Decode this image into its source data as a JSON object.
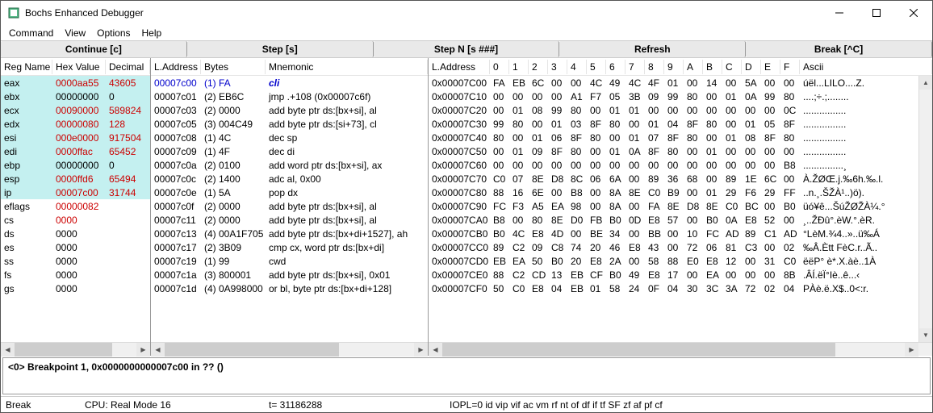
{
  "window": {
    "title": "Bochs Enhanced Debugger"
  },
  "menu": {
    "items": [
      "Command",
      "View",
      "Options",
      "Help"
    ]
  },
  "toolbar": {
    "buttons": [
      "Continue [c]",
      "Step [s]",
      "Step N [s ###]",
      "Refresh",
      "Break [^C]"
    ]
  },
  "registers": {
    "headers": [
      "Reg Name",
      "Hex Value",
      "Decimal"
    ],
    "rows": [
      {
        "name": "eax",
        "hex": "0000aa55",
        "dec": "43605",
        "hl": true,
        "red": true
      },
      {
        "name": "ebx",
        "hex": "00000000",
        "dec": "0",
        "hl": true,
        "red": false
      },
      {
        "name": "ecx",
        "hex": "00090000",
        "dec": "589824",
        "hl": true,
        "red": true
      },
      {
        "name": "edx",
        "hex": "00000080",
        "dec": "128",
        "hl": true,
        "red": true
      },
      {
        "name": "esi",
        "hex": "000e0000",
        "dec": "917504",
        "hl": true,
        "red": true
      },
      {
        "name": "edi",
        "hex": "0000ffac",
        "dec": "65452",
        "hl": true,
        "red": true
      },
      {
        "name": "ebp",
        "hex": "00000000",
        "dec": "0",
        "hl": true,
        "red": false
      },
      {
        "name": "esp",
        "hex": "0000ffd6",
        "dec": "65494",
        "hl": true,
        "red": true
      },
      {
        "name": "ip",
        "hex": "00007c00",
        "dec": "31744",
        "hl": true,
        "red": true
      },
      {
        "name": "eflags",
        "hex": "00000082",
        "dec": "",
        "hl": false,
        "red": true
      },
      {
        "name": "cs",
        "hex": "0000",
        "dec": "",
        "hl": false,
        "red": true
      },
      {
        "name": "ds",
        "hex": "0000",
        "dec": "",
        "hl": false,
        "red": false
      },
      {
        "name": "es",
        "hex": "0000",
        "dec": "",
        "hl": false,
        "red": false
      },
      {
        "name": "ss",
        "hex": "0000",
        "dec": "",
        "hl": false,
        "red": false
      },
      {
        "name": "fs",
        "hex": "0000",
        "dec": "",
        "hl": false,
        "red": false
      },
      {
        "name": "gs",
        "hex": "0000",
        "dec": "",
        "hl": false,
        "red": false
      }
    ]
  },
  "disasm": {
    "headers": [
      "L.Address",
      "Bytes",
      "Mnemonic"
    ],
    "rows": [
      {
        "addr": "00007c00",
        "bytes": "(1) FA",
        "mnem": "cli",
        "hl": true
      },
      {
        "addr": "00007c01",
        "bytes": "(2) EB6C",
        "mnem": "jmp .+108 (0x00007c6f)"
      },
      {
        "addr": "00007c03",
        "bytes": "(2) 0000",
        "mnem": "add byte ptr ds:[bx+si], al"
      },
      {
        "addr": "00007c05",
        "bytes": "(3) 004C49",
        "mnem": "add byte ptr ds:[si+73], cl"
      },
      {
        "addr": "00007c08",
        "bytes": "(1) 4C",
        "mnem": "dec sp"
      },
      {
        "addr": "00007c09",
        "bytes": "(1) 4F",
        "mnem": "dec di"
      },
      {
        "addr": "00007c0a",
        "bytes": "(2) 0100",
        "mnem": "add word ptr ds:[bx+si], ax"
      },
      {
        "addr": "00007c0c",
        "bytes": "(2) 1400",
        "mnem": "adc al, 0x00"
      },
      {
        "addr": "00007c0e",
        "bytes": "(1) 5A",
        "mnem": "pop dx"
      },
      {
        "addr": "00007c0f",
        "bytes": "(2) 0000",
        "mnem": "add byte ptr ds:[bx+si], al"
      },
      {
        "addr": "00007c11",
        "bytes": "(2) 0000",
        "mnem": "add byte ptr ds:[bx+si], al"
      },
      {
        "addr": "00007c13",
        "bytes": "(4) 00A1F705",
        "mnem": "add byte ptr ds:[bx+di+1527], ah"
      },
      {
        "addr": "00007c17",
        "bytes": "(2) 3B09",
        "mnem": "cmp cx, word ptr ds:[bx+di]"
      },
      {
        "addr": "00007c19",
        "bytes": "(1) 99",
        "mnem": "cwd"
      },
      {
        "addr": "00007c1a",
        "bytes": "(3) 800001",
        "mnem": "add byte ptr ds:[bx+si], 0x01"
      },
      {
        "addr": "00007c1d",
        "bytes": "(4) 0A998000",
        "mnem": "or bl, byte ptr ds:[bx+di+128]"
      }
    ]
  },
  "memory": {
    "headers": [
      "L.Address",
      "0",
      "1",
      "2",
      "3",
      "4",
      "5",
      "6",
      "7",
      "8",
      "9",
      "A",
      "B",
      "C",
      "D",
      "E",
      "F",
      "Ascii"
    ],
    "rows": [
      {
        "addr": "0x00007C00",
        "b": [
          "FA",
          "EB",
          "6C",
          "00",
          "00",
          "4C",
          "49",
          "4C",
          "4F",
          "01",
          "00",
          "14",
          "00",
          "5A",
          "00",
          "00"
        ],
        "ascii": "úël...LILO....Z."
      },
      {
        "addr": "0x00007C10",
        "b": [
          "00",
          "00",
          "00",
          "00",
          "A1",
          "F7",
          "05",
          "3B",
          "09",
          "99",
          "80",
          "00",
          "01",
          "0A",
          "99",
          "80"
        ],
        "ascii": "....;÷.;........"
      },
      {
        "addr": "0x00007C20",
        "b": [
          "00",
          "01",
          "08",
          "99",
          "80",
          "00",
          "01",
          "01",
          "00",
          "00",
          "00",
          "00",
          "00",
          "00",
          "00",
          "0C"
        ],
        "ascii": "................"
      },
      {
        "addr": "0x00007C30",
        "b": [
          "99",
          "80",
          "00",
          "01",
          "03",
          "8F",
          "80",
          "00",
          "01",
          "04",
          "8F",
          "80",
          "00",
          "01",
          "05",
          "8F"
        ],
        "ascii": "................"
      },
      {
        "addr": "0x00007C40",
        "b": [
          "80",
          "00",
          "01",
          "06",
          "8F",
          "80",
          "00",
          "01",
          "07",
          "8F",
          "80",
          "00",
          "01",
          "08",
          "8F",
          "80"
        ],
        "ascii": "................"
      },
      {
        "addr": "0x00007C50",
        "b": [
          "00",
          "01",
          "09",
          "8F",
          "80",
          "00",
          "01",
          "0A",
          "8F",
          "80",
          "00",
          "01",
          "00",
          "00",
          "00",
          "00"
        ],
        "ascii": "................"
      },
      {
        "addr": "0x00007C60",
        "b": [
          "00",
          "00",
          "00",
          "00",
          "00",
          "00",
          "00",
          "00",
          "00",
          "00",
          "00",
          "00",
          "00",
          "00",
          "00",
          "B8"
        ],
        "ascii": "...............¸"
      },
      {
        "addr": "0x00007C70",
        "b": [
          "C0",
          "07",
          "8E",
          "D8",
          "8C",
          "06",
          "6A",
          "00",
          "89",
          "36",
          "68",
          "00",
          "89",
          "1E",
          "6C",
          "00"
        ],
        "ascii": "À.ŽØŒ.j.‰6h.‰.l."
      },
      {
        "addr": "0x00007C80",
        "b": [
          "88",
          "16",
          "6E",
          "00",
          "B8",
          "00",
          "8A",
          "8E",
          "C0",
          "B9",
          "00",
          "01",
          "29",
          "F6",
          "29",
          "FF"
        ],
        "ascii": "..n.¸.ŠŽÀ¹..)ö)."
      },
      {
        "addr": "0x00007C90",
        "b": [
          "FC",
          "F3",
          "A5",
          "EA",
          "98",
          "00",
          "8A",
          "00",
          "FA",
          "8E",
          "D8",
          "8E",
          "C0",
          "BC",
          "00",
          "B0"
        ],
        "ascii": "üó¥ê...ŠúŽØŽÀ¼.°"
      },
      {
        "addr": "0x00007CA0",
        "b": [
          "B8",
          "00",
          "80",
          "8E",
          "D0",
          "FB",
          "B0",
          "0D",
          "E8",
          "57",
          "00",
          "B0",
          "0A",
          "E8",
          "52",
          "00"
        ],
        "ascii": "¸..ŽÐû°.èW.°.èR."
      },
      {
        "addr": "0x00007CB0",
        "b": [
          "B0",
          "4C",
          "E8",
          "4D",
          "00",
          "BE",
          "34",
          "00",
          "BB",
          "00",
          "10",
          "FC",
          "AD",
          "89",
          "C1",
          "AD"
        ],
        "ascii": "°LèM.¾4..»..ü­‰Á­"
      },
      {
        "addr": "0x00007CC0",
        "b": [
          "89",
          "C2",
          "09",
          "C8",
          "74",
          "20",
          "46",
          "E8",
          "43",
          "00",
          "72",
          "06",
          "81",
          "C3",
          "00",
          "02"
        ],
        "ascii": "‰Â.Ètt FèC.r..Ã.."
      },
      {
        "addr": "0x00007CD0",
        "b": [
          "EB",
          "EA",
          "50",
          "B0",
          "20",
          "E8",
          "2A",
          "00",
          "58",
          "88",
          "E0",
          "E8",
          "12",
          "00",
          "31",
          "C0"
        ],
        "ascii": "ëëP° è*.X.àè..1À"
      },
      {
        "addr": "0x00007CE0",
        "b": [
          "88",
          "C2",
          "CD",
          "13",
          "EB",
          "CF",
          "B0",
          "49",
          "E8",
          "17",
          "00",
          "EA",
          "00",
          "00",
          "00",
          "8B"
        ],
        "ascii": ".ÂÍ.ëÏ°Iè..ê...‹"
      },
      {
        "addr": "0x00007CF0",
        "b": [
          "50",
          "C0",
          "E8",
          "04",
          "EB",
          "01",
          "58",
          "24",
          "0F",
          "04",
          "30",
          "3C",
          "3A",
          "72",
          "02",
          "04"
        ],
        "ascii": "PÀè.ë.X$..0<:r."
      }
    ]
  },
  "console": {
    "line": "<0> Breakpoint 1, 0x0000000000007c00 in ?? ()"
  },
  "status": {
    "cells": [
      "Break",
      "CPU: Real Mode 16",
      "t= 31186288",
      "IOPL=0 id vip vif ac vm rf nt of df if tf SF zf af pf cf"
    ]
  }
}
